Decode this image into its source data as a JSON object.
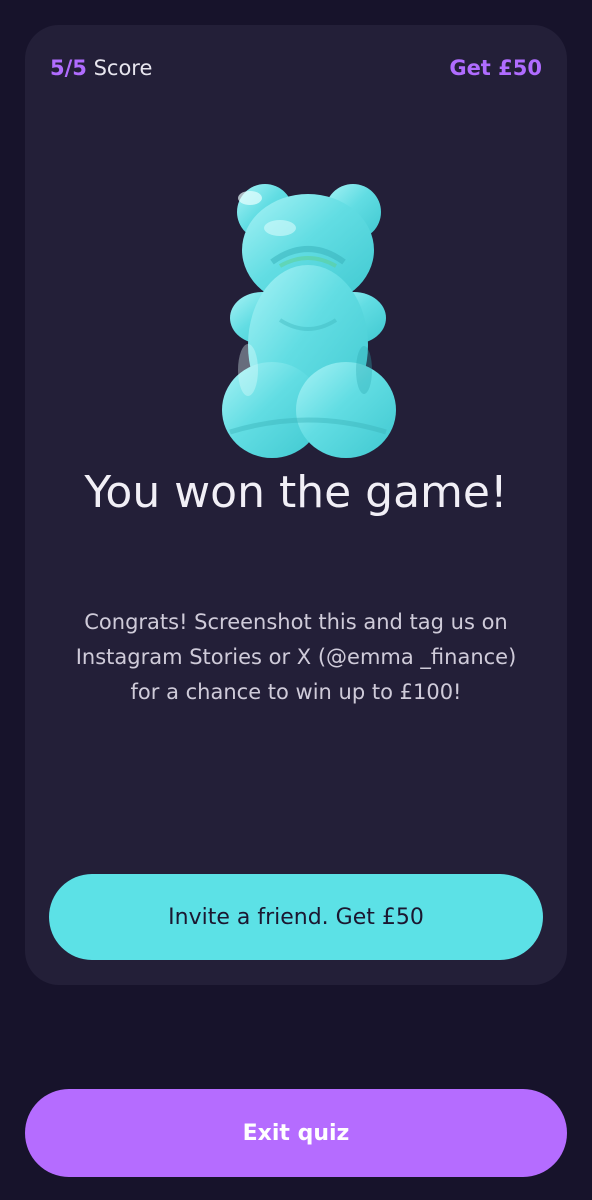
{
  "header": {
    "score_value": "5/5",
    "score_label": " Score",
    "reward_link": "Get £50"
  },
  "hero": {
    "illustration": "gummy-bear-icon",
    "title": "You won the game!",
    "message": "Congrats! Screenshot this and tag us on Instagram Stories or X (@emma _finance) for a chance to win up to £100!"
  },
  "actions": {
    "invite_label": "Invite a friend. Get £50",
    "exit_label": "Exit quiz"
  },
  "colors": {
    "background": "#17132b",
    "card": "#231f38",
    "accent_purple": "#b56cff",
    "accent_cyan": "#5ce1e6"
  }
}
